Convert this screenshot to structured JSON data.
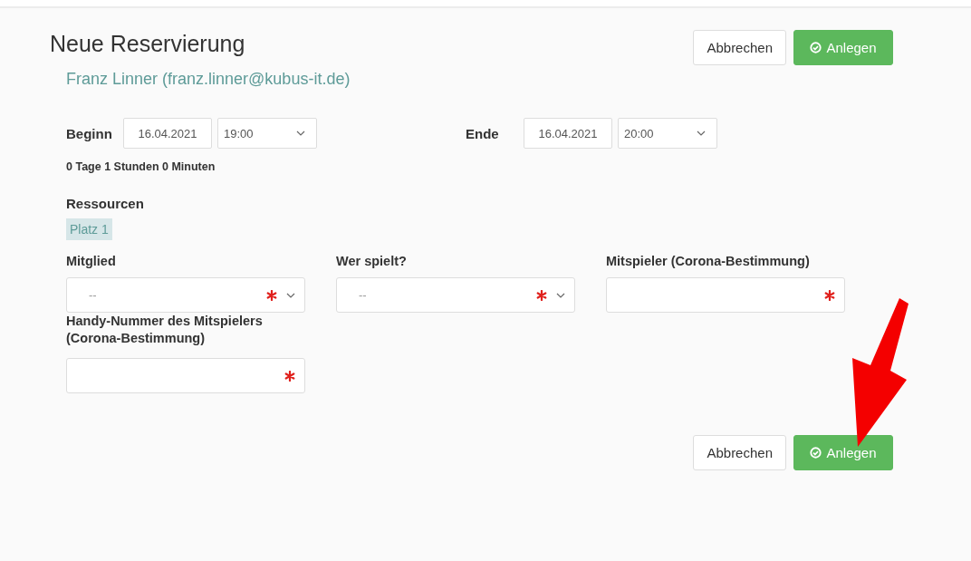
{
  "header": {
    "title": "Neue Reservierung",
    "user": "Franz Linner (franz.linner@kubus-it.de)",
    "buttons": [
      {
        "label": "Abbrechen",
        "kind": "default"
      },
      {
        "label": "Anlegen",
        "kind": "primary"
      }
    ]
  },
  "period": [
    {
      "label": "Beginn",
      "date": "16.04.2021",
      "time": "19:00"
    },
    {
      "label": "Ende",
      "date": "16.04.2021",
      "time": "20:00"
    }
  ],
  "duration": "0 Tage 1 Stunden 0 Minuten",
  "resources": {
    "label": "Ressourcen",
    "tags": [
      "Platz 1"
    ]
  },
  "fields": [
    {
      "label": "Mitglied",
      "kind": "select",
      "value": "--",
      "required": true
    },
    {
      "label": "Wer spielt?",
      "kind": "select",
      "value": "--",
      "required": true
    },
    {
      "label": "Mitspieler (Corona-Bestimmung)",
      "kind": "text",
      "required": true
    },
    {
      "label": "Handy-Nummer des Mitspielers (Corona-Bestimmung)",
      "kind": "text",
      "required": true
    }
  ],
  "footer_buttons": [
    {
      "label": "Abbrechen",
      "kind": "default"
    },
    {
      "label": "Anlegen",
      "kind": "primary"
    }
  ]
}
